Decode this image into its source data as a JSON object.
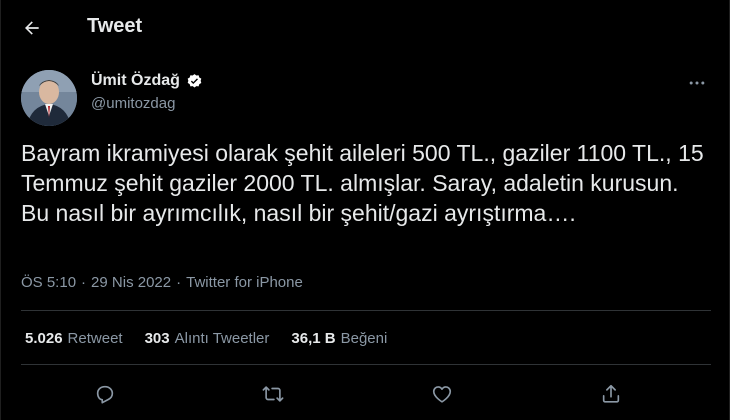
{
  "header": {
    "title": "Tweet"
  },
  "author": {
    "display_name": "Ümit Özdağ",
    "handle": "@umitozdag"
  },
  "tweet": {
    "text": "Bayram ikramiyesi olarak şehit aileleri 500 TL., gaziler 1100 TL., 15 Temmuz şehit gaziler 2000 TL. almışlar. Saray, adaletin kurusun. Bu nasıl bir ayrımcılık, nasıl bir şehit/gazi ayrıştırma…."
  },
  "meta": {
    "time": "ÖS 5:10",
    "date": "29 Nis 2022",
    "source": "Twitter for iPhone",
    "separator": "·"
  },
  "stats": {
    "retweets_count": "5.026",
    "retweets_label": "Retweet",
    "quotes_count": "303",
    "quotes_label": "Alıntı Tweetler",
    "likes_count": "36,1 B",
    "likes_label": "Beğeni"
  },
  "colors": {
    "background": "#000000",
    "text": "#e7e9ea",
    "secondary": "#8b98a5",
    "divider": "#2f3336",
    "verified": "#ffffff"
  },
  "icons": {
    "back": "arrow-left-icon",
    "verified": "verified-badge-icon",
    "more": "more-horizontal-icon",
    "reply": "reply-icon",
    "retweet": "retweet-icon",
    "like": "heart-icon",
    "share": "share-icon"
  }
}
